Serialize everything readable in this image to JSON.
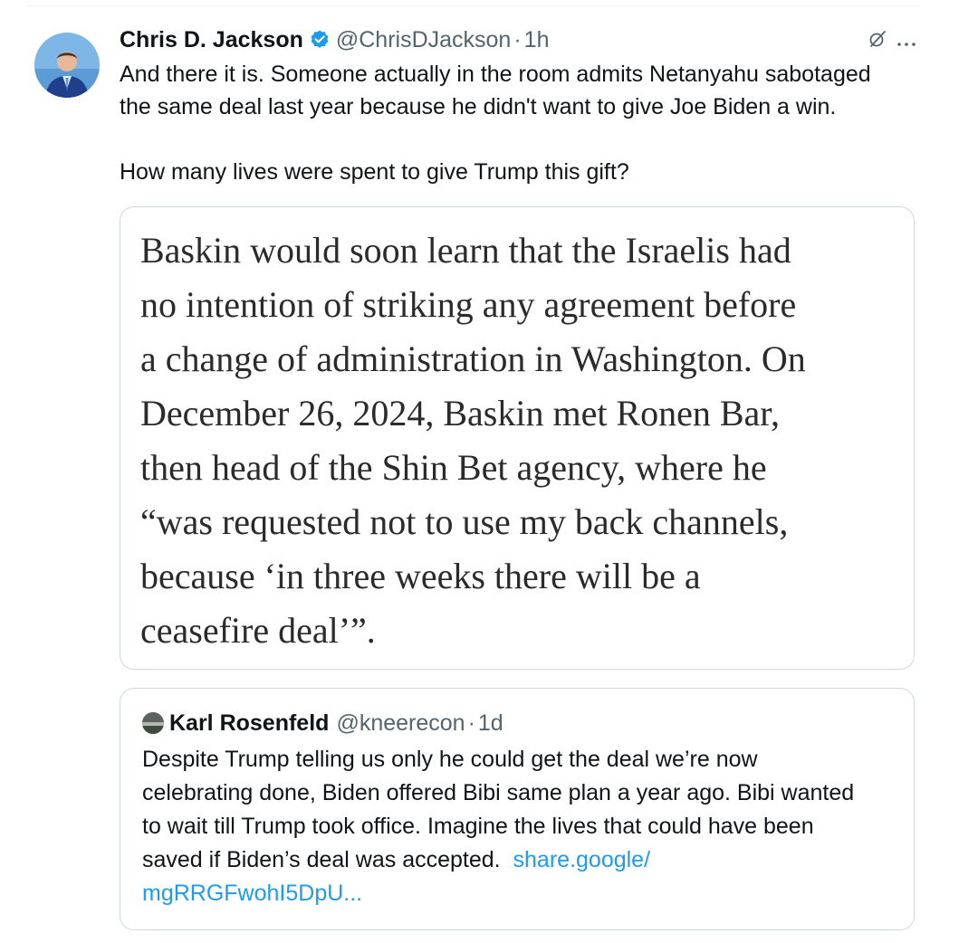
{
  "tweet": {
    "author_name": "Chris D. Jackson",
    "verified": true,
    "handle": "@ChrisDJackson",
    "separator": "·",
    "time": "1h",
    "text_line1": "And there it is. Someone actually in the room admits Netanyahu sabotaged",
    "text_line2": "the same deal last year because he didn't want to give Joe Biden a win.",
    "text_line3": "How many lives were spent to give Trump this gift?",
    "icons": {
      "grok": "grok-icon",
      "more": "more-icon",
      "verified": "verified-badge-icon"
    }
  },
  "image_card": {
    "line1": "Baskin would soon learn that the Israelis had",
    "line2": "no intention of striking any agreement before",
    "line3": "a change of administration in Washington. On",
    "line4": "December 26, 2024, Baskin met Ronen Bar,",
    "line5": "then head of the Shin Bet agency, where he",
    "line6": "“was requested not to use my back channels,",
    "line7": "because ‘in three weeks there will be a",
    "line8": "ceasefire deal’”."
  },
  "quoted_tweet": {
    "author_name": "Karl Rosenfeld",
    "handle": "@kneerecon",
    "separator": "·",
    "time": "1d",
    "line1": "Despite Trump telling us only he could get the deal we’re now",
    "line2": "celebrating done, Biden offered Bibi same plan a year ago. Bibi wanted",
    "line3": "to wait till Trump took office. Imagine the lives that could have been",
    "line4": "saved if Biden’s deal was accepted.",
    "link_part1": "share.google/",
    "link_part2": "mgRRGFwohI5DpU..."
  },
  "colors": {
    "text": "#0f1419",
    "secondary": "#536471",
    "link": "#1d9bf0",
    "verified": "#1d9bf0",
    "border": "#cfd9de"
  }
}
